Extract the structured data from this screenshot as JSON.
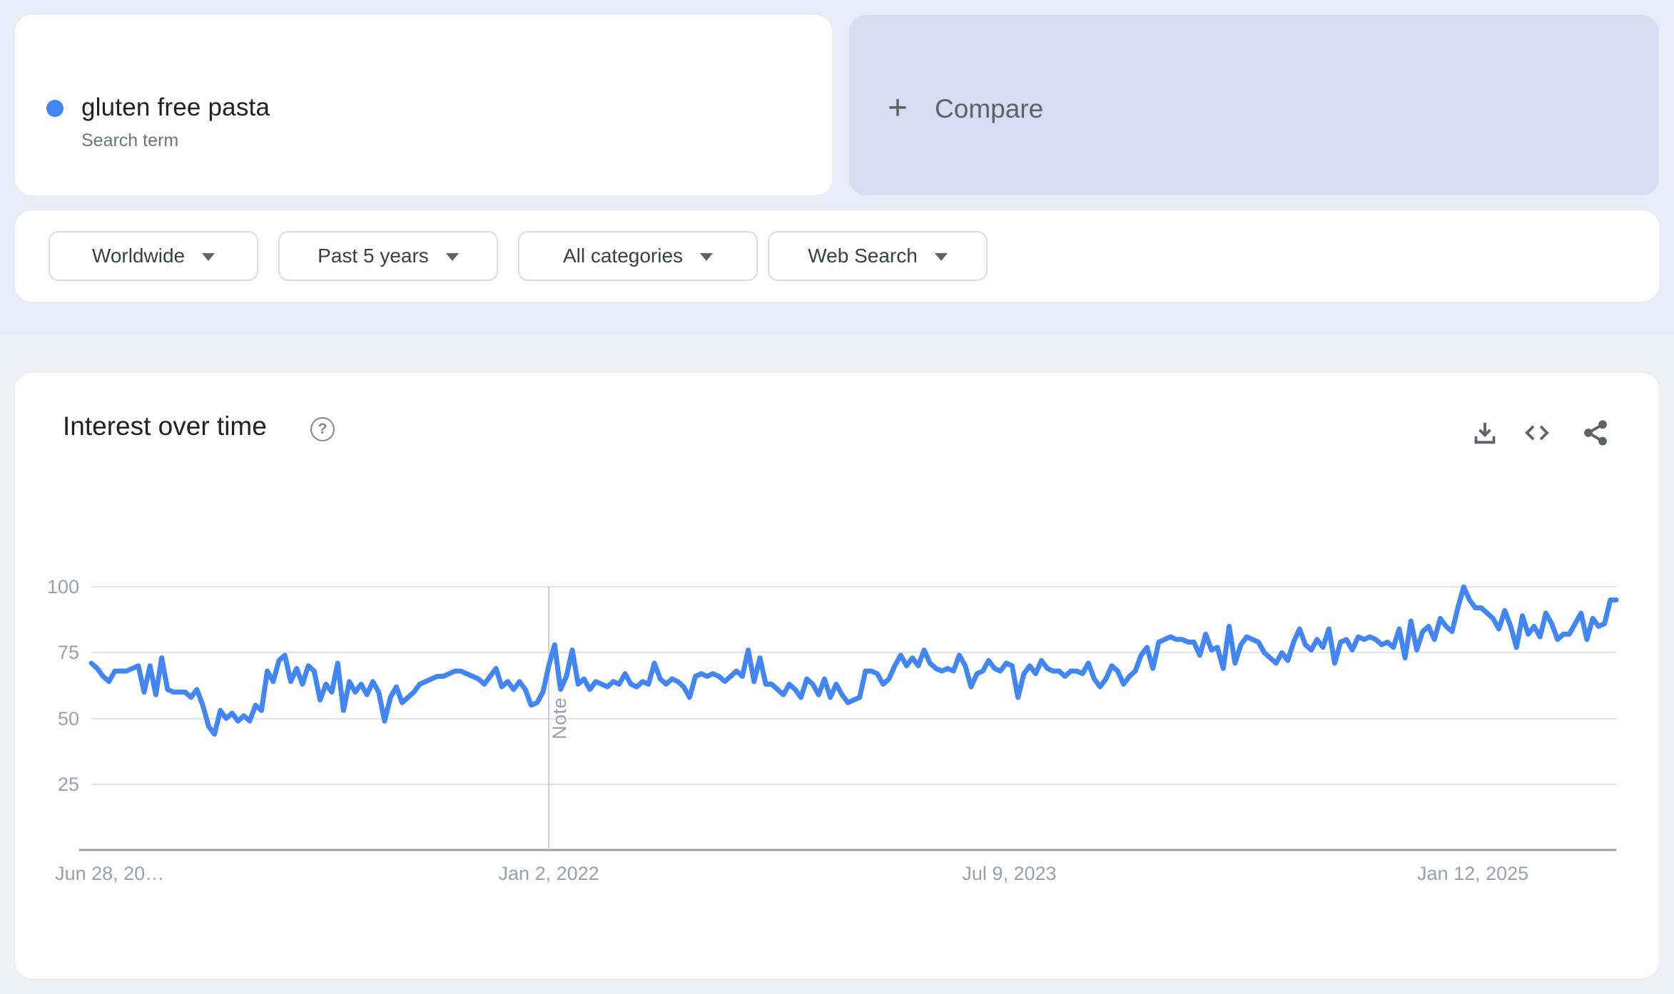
{
  "term_card": {
    "label": "gluten free pasta",
    "sublabel": "Search term",
    "dot_color": "#4285f4"
  },
  "compare_card": {
    "plus": "+",
    "label": "Compare"
  },
  "filters": [
    {
      "label": "Worldwide"
    },
    {
      "label": "Past 5 years"
    },
    {
      "label": "All categories"
    },
    {
      "label": "Web Search"
    }
  ],
  "panel": {
    "title": "Interest over time",
    "help_glyph": "?",
    "actions": [
      {
        "icon": "download-icon"
      },
      {
        "icon": "embed-icon"
      },
      {
        "icon": "share-icon"
      }
    ]
  },
  "chart_data": {
    "type": "line",
    "title": "Interest over time",
    "x_start": "Jun 28, 2020",
    "x_frequency": "weekly",
    "x_range": "Past 5 years",
    "ylim": [
      0,
      100
    ],
    "yticks": [
      100,
      75,
      50,
      25
    ],
    "ytick_labels": [
      "100",
      "75",
      "50",
      "25"
    ],
    "xtick_labels": [
      "Jun 28, 20…",
      "Jan 2, 2022",
      "Jul 9, 2023",
      "Jan 12, 2025"
    ],
    "xtick_fracs": [
      0.012,
      0.3,
      0.602,
      0.906
    ],
    "note_label": "Note",
    "note_frac": 0.3,
    "grid": "horizontal",
    "line_color": "#4285f4",
    "series": [
      {
        "name": "gluten free pasta",
        "color": "#4285f4",
        "values": [
          71,
          69,
          66,
          64,
          68,
          68,
          68,
          69,
          70,
          60,
          70,
          59,
          73,
          61,
          60,
          60,
          60,
          58,
          61,
          55,
          47,
          44,
          53,
          50,
          52,
          49,
          51,
          49,
          55,
          53,
          68,
          64,
          72,
          74,
          64,
          69,
          63,
          70,
          68,
          57,
          63,
          60,
          71,
          53,
          64,
          60,
          63,
          59,
          64,
          60,
          49,
          58,
          62,
          56,
          58,
          60,
          63,
          64,
          65,
          66,
          66,
          67,
          68,
          68,
          67,
          66,
          65,
          63,
          66,
          69,
          62,
          64,
          61,
          64,
          61,
          55,
          56,
          60,
          70,
          78,
          61,
          66,
          76,
          63,
          65,
          61,
          64,
          63,
          62,
          64,
          63,
          67,
          63,
          62,
          64,
          63,
          71,
          65,
          63,
          65,
          64,
          62,
          58,
          66,
          67,
          66,
          67,
          66,
          64,
          66,
          68,
          66,
          76,
          64,
          73,
          63,
          63,
          61,
          59,
          63,
          61,
          58,
          65,
          63,
          59,
          65,
          58,
          63,
          59,
          56,
          57,
          58,
          68,
          68,
          67,
          63,
          65,
          70,
          74,
          70,
          73,
          70,
          76,
          71,
          69,
          68,
          69,
          68,
          74,
          70,
          62,
          67,
          68,
          72,
          69,
          68,
          71,
          70,
          58,
          67,
          70,
          67,
          72,
          69,
          68,
          68,
          66,
          68,
          68,
          67,
          71,
          65,
          62,
          65,
          70,
          68,
          63,
          66,
          68,
          74,
          77,
          69,
          79,
          80,
          81,
          80,
          80,
          79,
          79,
          74,
          82,
          76,
          77,
          69,
          85,
          71,
          78,
          81,
          80,
          79,
          75,
          73,
          71,
          75,
          72,
          79,
          84,
          78,
          76,
          80,
          77,
          84,
          71,
          79,
          80,
          76,
          81,
          80,
          81,
          80,
          78,
          79,
          77,
          84,
          73,
          87,
          76,
          83,
          85,
          80,
          88,
          85,
          83,
          92,
          100,
          95,
          92,
          92,
          90,
          88,
          84,
          91,
          85,
          77,
          89,
          82,
          85,
          81,
          90,
          86,
          80,
          82,
          82,
          86,
          90,
          80,
          88,
          85,
          86,
          95,
          95
        ]
      }
    ]
  }
}
